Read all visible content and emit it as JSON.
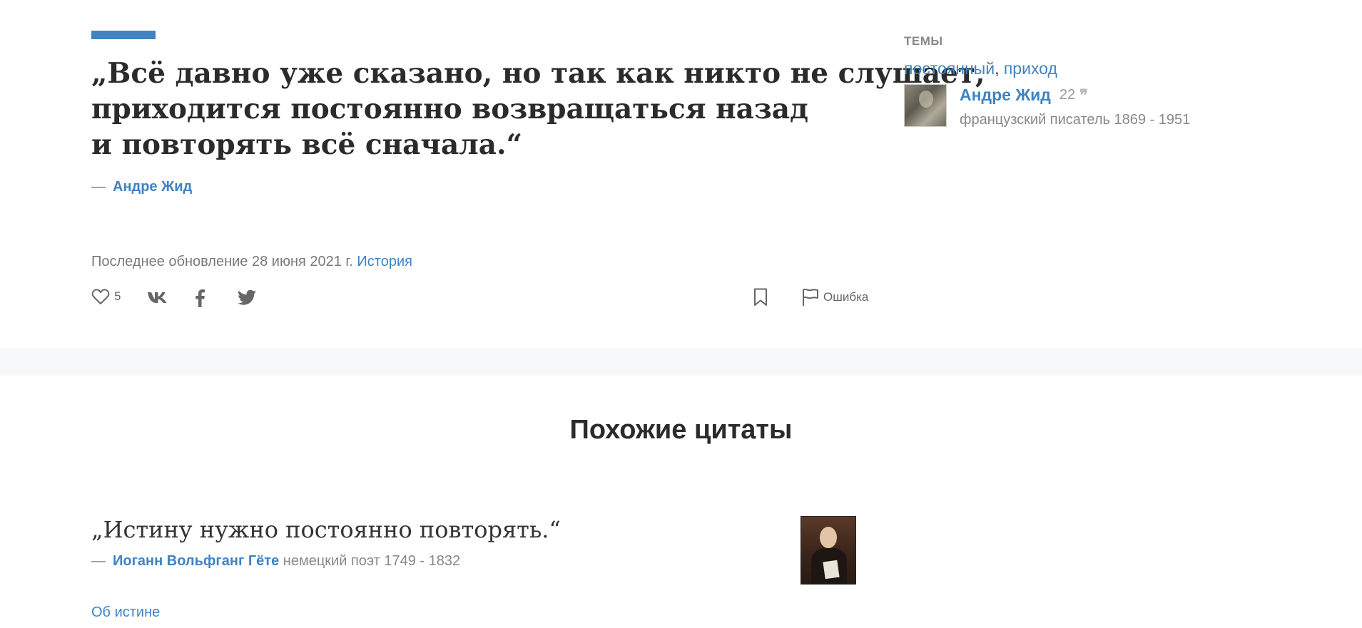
{
  "quote": {
    "lines": [
      "„Всё давно уже сказано, но так как никто не слушает,",
      "приходится постоянно возвращаться назад",
      "и повторять всё сначала.“"
    ],
    "dash": "—",
    "author": "Андре Жид"
  },
  "meta": {
    "updated_text": "Последнее обновление 28 июня 2021 г.",
    "history_link": "История"
  },
  "actions": {
    "like_count": "5",
    "error_label": "Ошибка",
    "icons": [
      "heart-icon",
      "vk-icon",
      "facebook-icon",
      "twitter-icon",
      "bookmark-icon",
      "flag-icon"
    ]
  },
  "sidebar": {
    "heading": "ТЕМЫ",
    "topics": [
      "постоянный",
      "приход"
    ],
    "topic_separator": ", ",
    "author_name": "Андре Жид",
    "author_quote_count": "22",
    "author_desc": "французский писатель 1869 - 1951"
  },
  "similar": {
    "title": "Похожие цитаты",
    "items": [
      {
        "quote": "„Истину нужно постоянно повторять.“",
        "dash": "—",
        "author": "Иоганн Вольфганг Гёте",
        "author_desc": "немецкий поэт 1749 - 1832",
        "topic": "Об истине"
      }
    ]
  },
  "colors": {
    "accent": "#3f83c4",
    "text": "#2b2b2b",
    "muted": "#888888",
    "band": "#f7f8fa"
  }
}
